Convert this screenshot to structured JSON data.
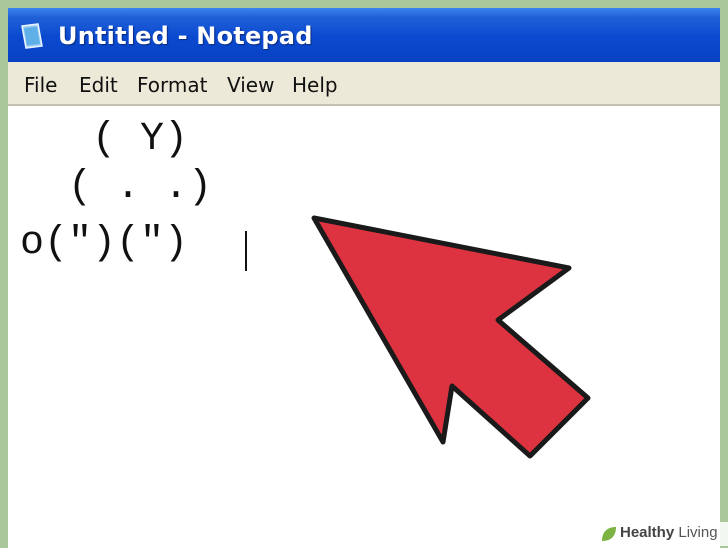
{
  "window": {
    "title": "Untitled - Notepad",
    "app_icon": "notepad-icon"
  },
  "menu": {
    "items": [
      "File",
      "Edit",
      "Format",
      "View",
      "Help"
    ]
  },
  "editor": {
    "lines": [
      "   ( Y)",
      "  ( . .)",
      "o(\")(\")"
    ]
  },
  "overlay": {
    "pointer_icon": "arrow-pointer-icon",
    "pointer_color": "#dd3340"
  },
  "watermark": {
    "brand_bold": "Healthy",
    "brand_regular": " Living",
    "icon": "leaf-icon"
  }
}
